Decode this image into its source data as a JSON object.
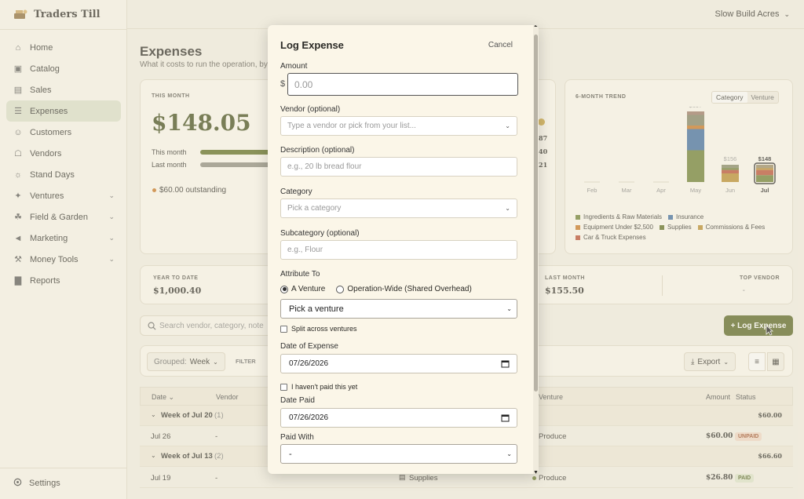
{
  "app": {
    "name": "Traders Till",
    "account": "Slow Build Acres"
  },
  "sidebar": {
    "items": [
      {
        "label": "Home",
        "icon": "home-icon"
      },
      {
        "label": "Catalog",
        "icon": "box-icon"
      },
      {
        "label": "Sales",
        "icon": "register-icon"
      },
      {
        "label": "Expenses",
        "icon": "receipt-icon",
        "active": true
      },
      {
        "label": "Customers",
        "icon": "users-icon"
      },
      {
        "label": "Vendors",
        "icon": "store-icon"
      },
      {
        "label": "Stand Days",
        "icon": "sun-icon"
      },
      {
        "label": "Ventures",
        "icon": "ventures-icon",
        "expand": true
      },
      {
        "label": "Field & Garden",
        "icon": "leaf-icon",
        "expand": true
      },
      {
        "label": "Marketing",
        "icon": "megaphone-icon",
        "expand": true
      },
      {
        "label": "Money Tools",
        "icon": "wallet-icon",
        "expand": true
      },
      {
        "label": "Reports",
        "icon": "chart-icon"
      }
    ],
    "settings": "Settings"
  },
  "page": {
    "title": "Expenses",
    "subtitle": "What it costs to run the operation, by"
  },
  "this_month": {
    "label": "THIS MONTH",
    "amount": "$148.05",
    "rows": [
      "This month",
      "Last month"
    ],
    "outstanding": "$60.00 outstanding",
    "bar_this": 0.95,
    "bar_last": 0.9
  },
  "peek_values": [
    "87",
    "40",
    "21"
  ],
  "trend": {
    "label": "6-MONTH TREND",
    "toggle": [
      "Category",
      "Venture"
    ],
    "months": [
      "Feb",
      "Mar",
      "Apr",
      "May",
      "Jun",
      "Jul"
    ],
    "totals": [
      "",
      "",
      "",
      "$697",
      "$156",
      "$148"
    ],
    "legend": [
      {
        "name": "Ingredients & Raw Materials",
        "color": "#6b7d2e"
      },
      {
        "name": "Insurance",
        "color": "#3b6aa0"
      },
      {
        "name": "Equipment Under $2,500",
        "color": "#c8731e"
      },
      {
        "name": "Supplies",
        "color": "#5b6a1e"
      },
      {
        "name": "Commissions & Fees",
        "color": "#b88b2a"
      },
      {
        "name": "Car & Truck Expenses",
        "color": "#b84a2e"
      }
    ]
  },
  "stats": {
    "ytd_label": "YEAR TO DATE",
    "ytd": "$1,000.40",
    "last_label": "LAST MONTH",
    "last": "$155.50",
    "top_label": "TOP VENDOR",
    "top": "-"
  },
  "search": {
    "placeholder": "Search vendor, category, note"
  },
  "toolbar": {
    "grouped_label": "Grouped:",
    "grouped_value": "Week",
    "filter": "FILTER",
    "log_button": "+ Log Expense",
    "export": "Export"
  },
  "table": {
    "headers": [
      "Date",
      "Vendor",
      "Venture",
      "Amount",
      "Status"
    ],
    "groups": [
      {
        "label": "Week of Jul 20",
        "count": "(1)",
        "total": "$60.00"
      },
      {
        "label": "Week of Jul 13",
        "count": "(2)",
        "total": "$66.60"
      }
    ],
    "rows": [
      {
        "date": "Jul 26",
        "vendor": "-",
        "category": "",
        "venture": "Produce",
        "amount": "$60.00",
        "status": "UNPAID"
      },
      {
        "date": "Jul 19",
        "vendor": "-",
        "category": "Supplies",
        "venture": "Produce",
        "amount": "$26.80",
        "status": "PAID"
      }
    ]
  },
  "modal": {
    "title": "Log Expense",
    "cancel": "Cancel",
    "amount_label": "Amount",
    "currency": "$",
    "amount_placeholder": "0.00",
    "vendor_label": "Vendor (optional)",
    "vendor_placeholder": "Type a vendor or pick from your list...",
    "desc_label": "Description (optional)",
    "desc_placeholder": "e.g., 20 lb bread flour",
    "category_label": "Category",
    "category_placeholder": "Pick a category",
    "subcat_label": "Subcategory (optional)",
    "subcat_placeholder": "e.g., Flour",
    "attribute_label": "Attribute To",
    "opt_venture": "A Venture",
    "opt_wide": "Operation-Wide (Shared Overhead)",
    "venture_select": "Pick a venture",
    "split_label": "Split across ventures",
    "date_label": "Date of Expense",
    "date_value": "07/26/2026",
    "unpaid_label": "I haven't paid this yet",
    "paid_label": "Date Paid",
    "paid_value": "07/26/2026",
    "paidwith_label": "Paid With",
    "paidwith_value": "-"
  }
}
